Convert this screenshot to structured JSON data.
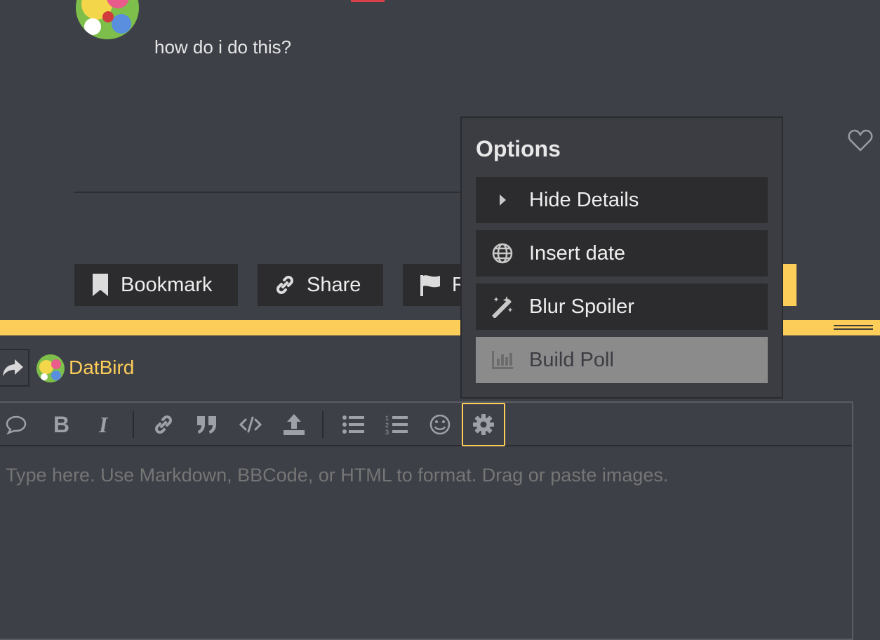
{
  "post": {
    "text": "how do i do this?"
  },
  "actions": {
    "bookmark_label": "Bookmark",
    "share_label": "Share",
    "report_label": "R"
  },
  "reply": {
    "username": "DatBird"
  },
  "editor": {
    "placeholder": "Type here. Use Markdown, BBCode, or HTML to format. Drag or paste images.",
    "toolbar_icons": [
      "speech-bubble-icon",
      "bold-icon",
      "italic-icon",
      "link-icon",
      "quote-icon",
      "code-icon",
      "upload-icon",
      "bullet-list-icon",
      "numbered-list-icon",
      "emoji-icon",
      "gear-icon"
    ]
  },
  "options_menu": {
    "title": "Options",
    "items": [
      {
        "label": "Hide Details",
        "icon": "caret-right-icon"
      },
      {
        "label": "Insert date",
        "icon": "globe-icon"
      },
      {
        "label": "Blur Spoiler",
        "icon": "magic-wand-icon"
      },
      {
        "label": "Build Poll",
        "icon": "bar-chart-icon",
        "state": "hovered"
      }
    ]
  },
  "colors": {
    "background": "#3e4048",
    "accent": "#fccd58",
    "menu_item": "#2c2c2e",
    "menu_item_hover": "#8b8b8b"
  }
}
